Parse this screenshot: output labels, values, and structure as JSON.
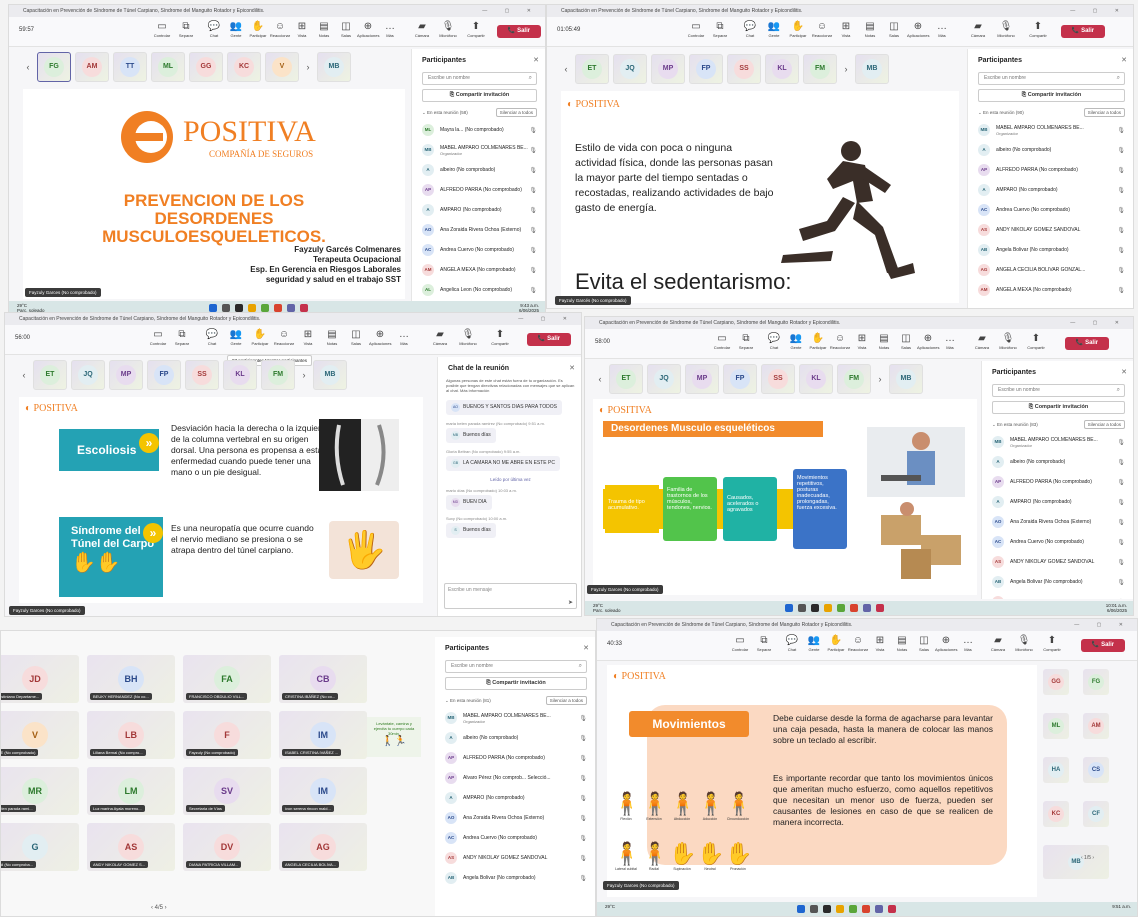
{
  "colors": {
    "purple": "#6264a7",
    "leave": "#c4314b",
    "orange": "#f28b2c",
    "teal": "#24a2b4",
    "positiva": "#f07f23"
  },
  "titlebar": "Capacitación en Prevención de Síndrome de Túnel Carpiano, Síndrome del Manguito Rotador y Epicondilitis.",
  "toolbar": {
    "controlar": "Controlar",
    "separar": "Separar",
    "chat": "Chat",
    "gente": "Gente",
    "participar": "Participar",
    "reaccionar": "Reaccionar",
    "vista": "Vista",
    "notas": "Notas",
    "salas": "Salas",
    "aplicaciones": "Aplicaciones",
    "mas": "Más",
    "camara": "Cámara",
    "microfono": "Micrófono",
    "compartir": "Compartir",
    "salir": "Salir"
  },
  "p1": {
    "timer": "59:57",
    "strip": [
      "FG",
      "AM",
      "TT",
      "ML",
      "GG",
      "KC",
      "V",
      "MB"
    ],
    "slide": {
      "logo": "POSITIVA",
      "sub": "COMPAÑÍA DE SEGUROS",
      "title1": "PREVENCION DE LOS",
      "title2": "DESORDENES",
      "title3": "MUSCULOESQUELETICOS.",
      "author": "Fayzuly Garcés Colmenares",
      "role": "Terapeuta Ocupacional",
      "spec": "Esp. En Gerencia en Riesgos Laborales",
      "spec2": "seguridad y salud en el trabajo SST"
    },
    "badge": "Fayzuly Garces (No comprobado)",
    "people": {
      "title": "Participantes",
      "search": "Escribe un nombre",
      "share": "Compartir invitación",
      "section": "En esta reunión (58)",
      "mute": "Silenciar a todos",
      "rows": [
        {
          "i": "ML",
          "n": "Mayra la... (No comprobado)"
        },
        {
          "i": "MB",
          "n": "MABEL AMPARO COLMENARES BE...",
          "s": "Organizador"
        },
        {
          "i": "A",
          "n": "albeiro (No comprobado)"
        },
        {
          "i": "AP",
          "n": "ALFREDO PARRA (No comprobado)"
        },
        {
          "i": "A",
          "n": "AMPARO (No comprobado)"
        },
        {
          "i": "AO",
          "n": "Ana Zoraida Rivera Ochoa (Externo)"
        },
        {
          "i": "AC",
          "n": "Andrea Cuervo (No comprobado)"
        },
        {
          "i": "AM",
          "n": "ANGELA MEXA (No comprobado)"
        },
        {
          "i": "AL",
          "n": "Angelica Leon (No comprobado)"
        }
      ]
    },
    "weather": "29°C",
    "weather2": "Parc. soleado",
    "clock": "9:43 a.m.",
    "date": "6/06/2025",
    "lang": "ESP LAA"
  },
  "p2": {
    "timer": "01:05:49",
    "strip": [
      "ET",
      "JQ",
      "MP",
      "FP",
      "SS",
      "KL",
      "FM",
      "MB"
    ],
    "slide": {
      "logo": "POSITIVA",
      "text": "Estilo de vida con poca o ninguna actividad física, donde las personas pasan la mayor parte del tiempo sentadas o recostadas, realizando actividades de bajo gasto de energía.",
      "big": "Evita el sedentarismo:"
    },
    "badge": "Fayzuly Garcés (No comprobado)",
    "people": {
      "title": "Participantes",
      "search": "Escribe un nombre",
      "share": "Compartir invitación",
      "section": "En esta reunión (90)",
      "mute": "Silenciar a todos",
      "rows": [
        {
          "i": "MB",
          "n": "MABEL AMPARO COLMENARES BE...",
          "s": "Organizador"
        },
        {
          "i": "A",
          "n": "albeiro (No comprobado)"
        },
        {
          "i": "AP",
          "n": "ALFREDO PARRA (No comprobado)"
        },
        {
          "i": "A",
          "n": "AMPARO (No comprobado)"
        },
        {
          "i": "AC",
          "n": "Andrea Cuervo (No comprobado)"
        },
        {
          "i": "AS",
          "n": "ANDY NIKOLAY GOMEZ SANDOVAL"
        },
        {
          "i": "AB",
          "n": "Angela Bolivar (No comprobado)"
        },
        {
          "i": "AG",
          "n": "ANGELA CECILIA BOLIVAR GONZAL..."
        },
        {
          "i": "AM",
          "n": "ANGELA MEXA (No comprobado)"
        }
      ]
    }
  },
  "p3": {
    "timer": "56:00",
    "strip": [
      "ET",
      "JQ",
      "MP",
      "FP",
      "SS",
      "KL",
      "FM",
      "MB"
    ],
    "tooltip": "87 participantes Mostrar participantes",
    "slide": {
      "logo": "POSITIVA",
      "t1": "Escoliosis",
      "d1": "Desviación hacia la derecha o la izquierda de la columna vertebral en su origen dorsal. Una persona es propensa a esta enfermedad cuando puede tener una mano o un pie desigual.",
      "t2a": "Síndrome del",
      "t2b": "Túnel del Carpo",
      "d2": "Es una neuropatía que ocurre cuando el nervio mediano se presiona o se atrapa dentro del túnel carpiano."
    },
    "badge": "Fayzuly Garces (No comprobado)",
    "chat": {
      "title": "Chat de la reunión",
      "notice": "Algunas personas de este chat están fuera de tu organización. Es posible que tengan directivas relacionadas con mensajes que se aplican al chat. Más información",
      "msgs": [
        {
          "m": "",
          "i": "AO",
          "t": "BUENOS Y SANTOS DIAS PARA TODOS"
        },
        {
          "m": "maria belen parada ramirez (No comprobado) 9:51 a.m.",
          "i": "MB",
          "t": "Buenos días"
        },
        {
          "m": "Gloria Beltran (No comprobado) 9:55 a.m.",
          "i": "GB",
          "t": "LA CAMARA NO ME ABRE EN ESTE PC"
        },
        {
          "m": "Leído por última vez",
          "i": "",
          "t": ""
        },
        {
          "m": "mario días (No comprobado) 10:03 a.m.",
          "i": "MD",
          "t": "BUEN DIA"
        },
        {
          "m": "Suxy (No comprobado) 10:00 a.m.",
          "i": "S",
          "t": "Buenos días"
        }
      ],
      "input": "Escribe un mensaje"
    }
  },
  "p4": {
    "timer": "58:00",
    "strip": [
      "ET",
      "JQ",
      "MP",
      "FP",
      "SS",
      "KL",
      "FM",
      "MB"
    ],
    "slide": {
      "logo": "POSITIVA",
      "title": "Desordenes Musculo esqueléticos",
      "b1": "Trauma de tipo acumulativo.",
      "b2": "Familia de trastornos de los músculos, tendones, nervios.",
      "b3": "Causados, acelerados o agravados",
      "b4": "Movimientos repetitivos, posturas inadecuadas, prolongadas, fuerza excesiva."
    },
    "badge": "Fayzuly Garces (No comprobado)",
    "people": {
      "title": "Participantes",
      "search": "Escribe un nombre",
      "share": "Compartir invitación",
      "section": "En esta reunión (83)",
      "mute": "Silenciar a todos",
      "rows": [
        {
          "i": "MB",
          "n": "MABEL AMPARO COLMENARES BE...",
          "s": "Organizador"
        },
        {
          "i": "A",
          "n": "albeiro (No comprobado)"
        },
        {
          "i": "AP",
          "n": "ALFREDO PARRA (No comprobado)"
        },
        {
          "i": "A",
          "n": "AMPARO (No comprobado)"
        },
        {
          "i": "AO",
          "n": "Ana Zoraida Rivera Ochoa (Externo)"
        },
        {
          "i": "AC",
          "n": "Andrea Cuervo (No comprobado)"
        },
        {
          "i": "AS",
          "n": "ANDY NIKOLAY GOMEZ SANDOVAL"
        },
        {
          "i": "AB",
          "n": "Angela Bolivar (No comprobado)"
        },
        {
          "i": "AG",
          "n": "ANGELA CECILIA BOLIVAR GONZAL..."
        }
      ]
    },
    "weather": "29°C",
    "weather2": "Parc. soleado",
    "clock": "10:01 a.m.",
    "date": "6/06/2025"
  },
  "p5": {
    "tiles": [
      {
        "i": "JD",
        "n": "Justiniano Departame..."
      },
      {
        "i": "BH",
        "n": "BEUKY HERNANDEZ (No co..."
      },
      {
        "i": "FA",
        "n": "FRANCISCO OBDULIO VILL..."
      },
      {
        "i": "CB",
        "n": "CRISTINA IBÁÑEZ (No co..."
      },
      {
        "i": "V",
        "n": "ITE (No comprobado)"
      },
      {
        "i": "LB",
        "n": "Liliana Bernal (No compro..."
      },
      {
        "i": "F",
        "n": "Fayzuly (No comprobado)"
      },
      {
        "i": "IM",
        "n": "ISABEL CRISTINA IVAÑEZ ..."
      },
      {
        "i": "MR",
        "n": "belen parada rami..."
      },
      {
        "i": "LM",
        "n": "Luz marina Ayala moreno..."
      },
      {
        "i": "SV",
        "n": "Secretaria de Vías"
      },
      {
        "i": "IM",
        "n": "ivon serena rincon mald..."
      },
      {
        "i": "G",
        "n": "onil (No comproba..."
      },
      {
        "i": "AS",
        "n": "ANDY NIKOLAY GOMEZ S..."
      },
      {
        "i": "DV",
        "n": "DIANA PATRICIA VILLAM..."
      },
      {
        "i": "AG",
        "n": "ANGELA CECILIA BOLIVA..."
      }
    ],
    "pager": "‹  4/5  ›",
    "shared": "Levántate, camina y ejercita tu cuerpo cada 30min.",
    "people": {
      "title": "Participantes",
      "search": "Escribe un nombre",
      "share": "Compartir invitación",
      "section": "En esta reunión (81)",
      "mute": "Silenciar a todos",
      "rows": [
        {
          "i": "MB",
          "n": "MABEL AMPARO COLMENARES BE...",
          "s": "Organizador"
        },
        {
          "i": "A",
          "n": "albeiro (No comprobado)"
        },
        {
          "i": "AP",
          "n": "ALFREDO PARRA (No comprobado)"
        },
        {
          "i": "AP",
          "n": "Alvaro Pérez (No comprob...  Selecció..."
        },
        {
          "i": "A",
          "n": "AMPARO (No comprobado)"
        },
        {
          "i": "AO",
          "n": "Ana Zoraida Rivera Ochoa (Externo)"
        },
        {
          "i": "AC",
          "n": "Andrea Cuervo (No comprobado)"
        },
        {
          "i": "AS",
          "n": "ANDY NIKOLAY GOMEZ SANDOVAL"
        },
        {
          "i": "AB",
          "n": "Angela Bolivar (No comprobado)"
        }
      ]
    }
  },
  "p6": {
    "timer": "40:33",
    "slide": {
      "logo": "POSITIVA",
      "title": "Movimientos",
      "p1": "Debe cuidarse desde la forma de agacharse para levantar una caja pesada, hasta la manera de colocar las manos sobre un teclado al escribir.",
      "p2": "Es importante recordar que tanto los movimientos únicos que ameritan mucho esfuerzo, como aquellos repetitivos que necesitan un menor uso de fuerza, pueden ser causantes de lesiones en caso de que se realicen de manera incorrecta.",
      "labels": [
        "Flexión",
        "Extensión",
        "Abducción",
        "Aducción",
        "Circunducción",
        "Lateral cubital",
        "Radial",
        "Supinación",
        "Neutral",
        "Pronación"
      ]
    },
    "tiles": [
      "GG",
      "FG",
      "ML",
      "AM",
      "HA",
      "CS",
      "KC",
      "CF",
      "MB"
    ],
    "pager": "‹  1/5  ›",
    "badge": "Fayzuly Garces (No comprobado)",
    "weather": "29°C",
    "clock": "9:51 a.m."
  }
}
